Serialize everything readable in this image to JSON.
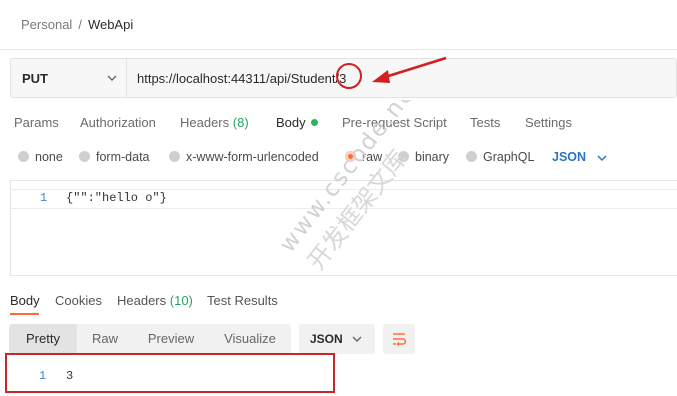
{
  "breadcrumb": {
    "parent": "Personal",
    "separator": "/",
    "current": "WebApi"
  },
  "request": {
    "method": "PUT",
    "url": "https://localhost:44311/api/Student/3"
  },
  "request_tabs": {
    "params": "Params",
    "authorization": "Authorization",
    "headers_label": "Headers",
    "headers_count": "(8)",
    "body": "Body",
    "pre_request_script": "Pre-request Script",
    "tests": "Tests",
    "settings": "Settings"
  },
  "body_types": {
    "none": "none",
    "form_data": "form-data",
    "urlencoded": "x-www-form-urlencoded",
    "raw": "raw",
    "binary": "binary",
    "graphql": "GraphQL",
    "selected": "raw",
    "language": "JSON"
  },
  "editor": {
    "line_number": "1",
    "code": "{\"\":\"hello o\"}"
  },
  "response_tabs": {
    "body": "Body",
    "cookies": "Cookies",
    "headers_label": "Headers",
    "headers_count": "(10)",
    "test_results": "Test Results"
  },
  "response_view": {
    "pretty": "Pretty",
    "raw": "Raw",
    "preview": "Preview",
    "visualize": "Visualize",
    "format": "JSON"
  },
  "response_body": {
    "line_number": "1",
    "code": "3"
  },
  "watermark": {
    "line1": "www.cscode.net",
    "line2": "开发框架文库"
  },
  "colors": {
    "accent": "#ff6c37",
    "body_dot": "#29b35e",
    "count_green": "#26a269",
    "language_blue": "#2d73c4",
    "annotation_red": "#d21f1f"
  }
}
